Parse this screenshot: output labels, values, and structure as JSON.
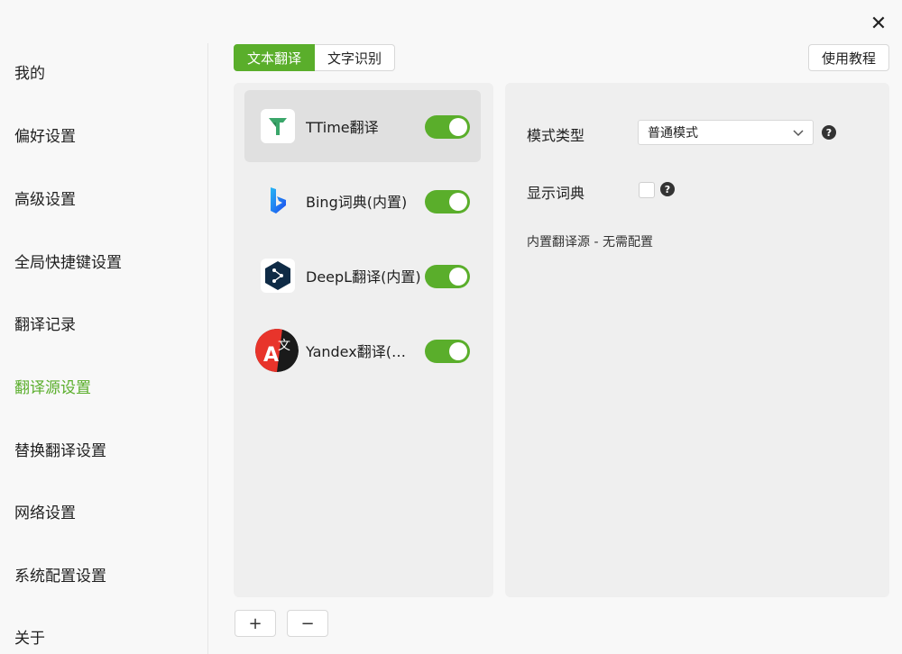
{
  "window": {
    "close_glyph": "✕"
  },
  "sidebar": {
    "items": [
      {
        "label": "我的"
      },
      {
        "label": "偏好设置"
      },
      {
        "label": "高级设置"
      },
      {
        "label": "全局快捷键设置"
      },
      {
        "label": "翻译记录"
      },
      {
        "label": "翻译源设置",
        "active": true
      },
      {
        "label": "替换翻译设置"
      },
      {
        "label": "网络设置"
      },
      {
        "label": "系统配置设置"
      },
      {
        "label": "关于"
      }
    ]
  },
  "tabs": [
    {
      "label": "文本翻译",
      "active": true
    },
    {
      "label": "文字识别",
      "active": false
    }
  ],
  "toolbar": {
    "tutorial_label": "使用教程"
  },
  "sources": [
    {
      "name": "TTime翻译",
      "enabled": true,
      "selected": true,
      "icon": "ttime-logo-icon"
    },
    {
      "name": "Bing词典(内置)",
      "enabled": true,
      "selected": false,
      "icon": "bing-logo-icon"
    },
    {
      "name": "DeepL翻译(内置)",
      "enabled": true,
      "selected": false,
      "icon": "deepl-logo-icon"
    },
    {
      "name": "Yandex翻译(内置)",
      "enabled": true,
      "selected": false,
      "icon": "yandex-logo-icon"
    }
  ],
  "source_actions": {
    "add": "+",
    "remove": "−"
  },
  "config": {
    "mode_label": "模式类型",
    "mode_value": "普通模式",
    "dict_label": "显示词典",
    "dict_checked": false,
    "help_glyph": "?",
    "note": "内置翻译源 - 无需配置"
  },
  "colors": {
    "accent": "#5aae2b",
    "panel": "#efefef",
    "selected": "#e0e0e0"
  }
}
